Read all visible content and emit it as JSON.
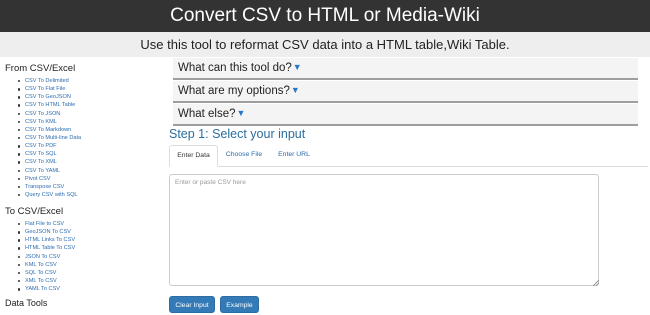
{
  "header": {
    "title": "Convert CSV to HTML or Media-Wiki",
    "subtitle": "Use this tool to reformat CSV data into a HTML table,Wiki Table."
  },
  "sidebar": {
    "from_title": "From CSV/Excel",
    "from_links": [
      "CSV To Delimited",
      "CSV To Flat File",
      "CSV To GeoJSON",
      "CSV To HTML Table",
      "CSV To JSON",
      "CSV To KML",
      "CSV To Markdown",
      "CSV To Multi-line Data",
      "CSV To PDF",
      "CSV To SQL",
      "CSV To XML",
      "CSV To YAML",
      "Pivot CSV",
      "Transpose CSV",
      "Query CSV with SQL"
    ],
    "to_title": "To CSV/Excel",
    "to_links": [
      "Flat File to CSV",
      "GeoJSON To CSV",
      "HTML Links To CSV",
      "HTML Table To CSV",
      "JSON To CSV",
      "KML To CSV",
      "SQL To CSV",
      "XML To CSV",
      "YAML To CSV"
    ],
    "data_tools_title": "Data Tools"
  },
  "accordion": [
    {
      "label": "What can this tool do?",
      "icon": "chevron-down-icon"
    },
    {
      "label": "What are my options?",
      "icon": "chevron-down-icon"
    },
    {
      "label": "What else?",
      "icon": "chevron-down-icon"
    }
  ],
  "step1": {
    "title": "Step 1: Select your input",
    "tabs": [
      "Enter Data",
      "Choose File",
      "Enter URL"
    ],
    "active_tab": "Enter Data",
    "input_value": "",
    "input_placeholder": "Enter or paste CSV here",
    "clear_label": "Clear Input",
    "example_label": "Example"
  },
  "colors": {
    "header_bg": "#333333",
    "subheader_bg": "#eeeeee",
    "link": "#2b6cb0",
    "step_title": "#2a6f9e",
    "button": "#337ab7"
  }
}
